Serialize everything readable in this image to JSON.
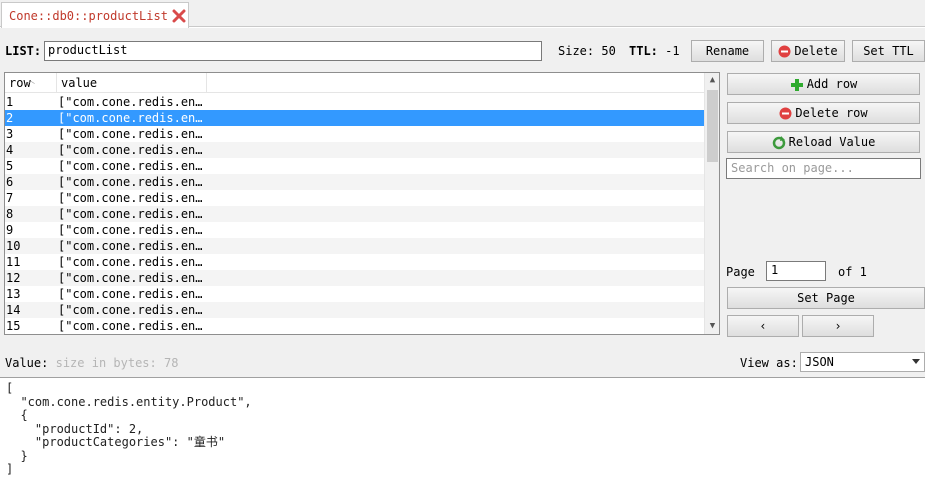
{
  "tab": {
    "title": "Cone::db0::productList"
  },
  "key_bar": {
    "list_label": "LIST:",
    "key_value": "productList",
    "size_text": "Size: 50",
    "ttl_label": "TTL:",
    "ttl_value": "-1",
    "rename_label": "Rename",
    "delete_label": "Delete",
    "set_ttl_label": "Set TTL"
  },
  "table": {
    "columns": [
      "row",
      "value"
    ],
    "rows": [
      {
        "row": "1",
        "value": "[\"com.cone.redis.en…"
      },
      {
        "row": "2",
        "value": "[\"com.cone.redis.en…"
      },
      {
        "row": "3",
        "value": "[\"com.cone.redis.en…"
      },
      {
        "row": "4",
        "value": "[\"com.cone.redis.en…"
      },
      {
        "row": "5",
        "value": "[\"com.cone.redis.en…"
      },
      {
        "row": "6",
        "value": "[\"com.cone.redis.en…"
      },
      {
        "row": "7",
        "value": "[\"com.cone.redis.en…"
      },
      {
        "row": "8",
        "value": "[\"com.cone.redis.en…"
      },
      {
        "row": "9",
        "value": "[\"com.cone.redis.en…"
      },
      {
        "row": "10",
        "value": "[\"com.cone.redis.en…"
      },
      {
        "row": "11",
        "value": "[\"com.cone.redis.en…"
      },
      {
        "row": "12",
        "value": "[\"com.cone.redis.en…"
      },
      {
        "row": "13",
        "value": "[\"com.cone.redis.en…"
      },
      {
        "row": "14",
        "value": "[\"com.cone.redis.en…"
      },
      {
        "row": "15",
        "value": "[\"com.cone.redis.en…"
      }
    ],
    "selected_row": "2"
  },
  "side_panel": {
    "add_row_label": "Add row",
    "delete_row_label": "Delete row",
    "reload_label": "Reload Value",
    "search_placeholder": "Search on page...",
    "page_label": "Page",
    "page_value": "1",
    "of_label": "of 1",
    "set_page_label": "Set Page",
    "prev_label": "‹",
    "next_label": "›"
  },
  "value_panel": {
    "value_label": "Value:",
    "size_hint": "size in bytes: 78",
    "view_as_label": "View as:",
    "view_as_value": "JSON",
    "content": "[\n  \"com.cone.redis.entity.Product\",\n  {\n    \"productId\": 2,\n    \"productCategories\": \"童书\"\n  }\n]"
  },
  "colors": {
    "selection": "#3399ff",
    "tab_title": "#c0392b",
    "add_icon": "#2eaa2e",
    "delete_icon": "#e04040"
  },
  "icons": [
    "close-icon",
    "delete-icon",
    "add-icon",
    "reload-icon",
    "sort-indicator-icon",
    "scroll-up-icon",
    "scroll-down-icon",
    "dropdown-caret-icon"
  ]
}
